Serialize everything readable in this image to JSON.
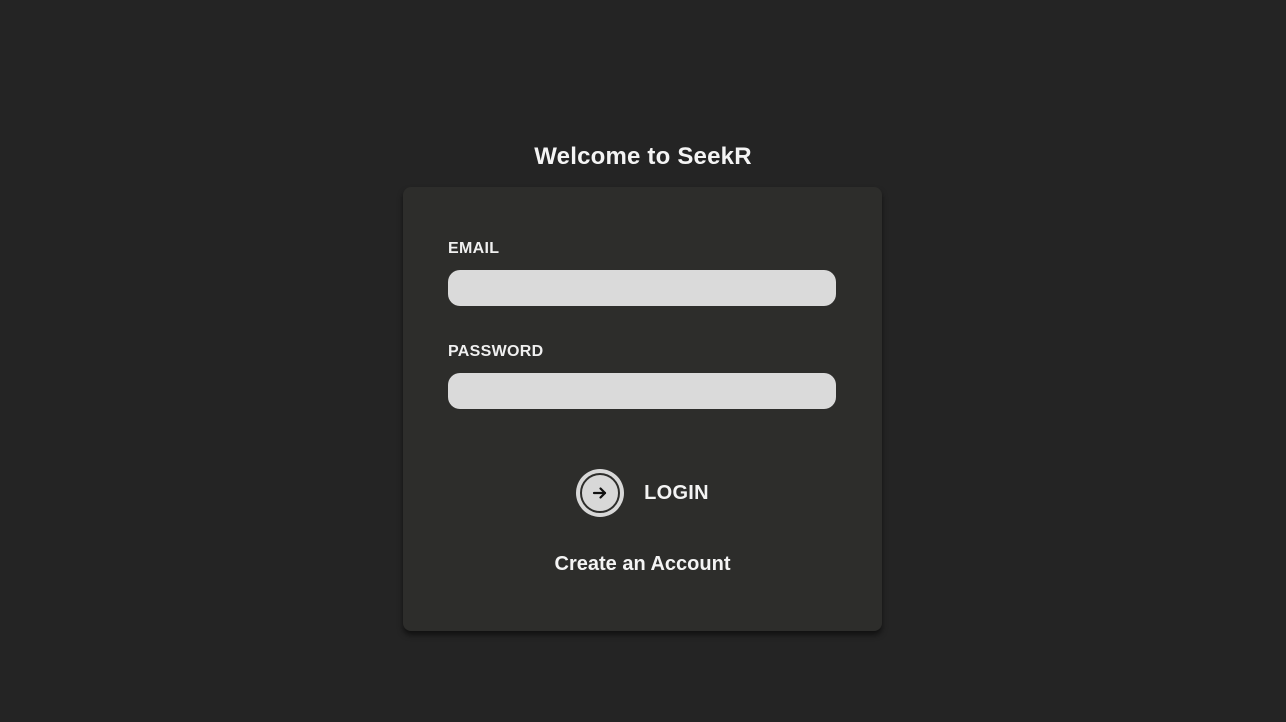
{
  "page": {
    "title": "Welcome to SeekR"
  },
  "login_form": {
    "email_label": "EMAIL",
    "email_value": "",
    "email_placeholder": "",
    "password_label": "PASSWORD",
    "password_value": "",
    "password_placeholder": "",
    "login_button_label": "LOGIN",
    "login_icon": "arrow-right-icon",
    "create_account_label": "Create an Account"
  },
  "colors": {
    "background": "#242424",
    "card": "#2d2d2b",
    "input": "#dadada",
    "text": "#f4f4f4"
  }
}
